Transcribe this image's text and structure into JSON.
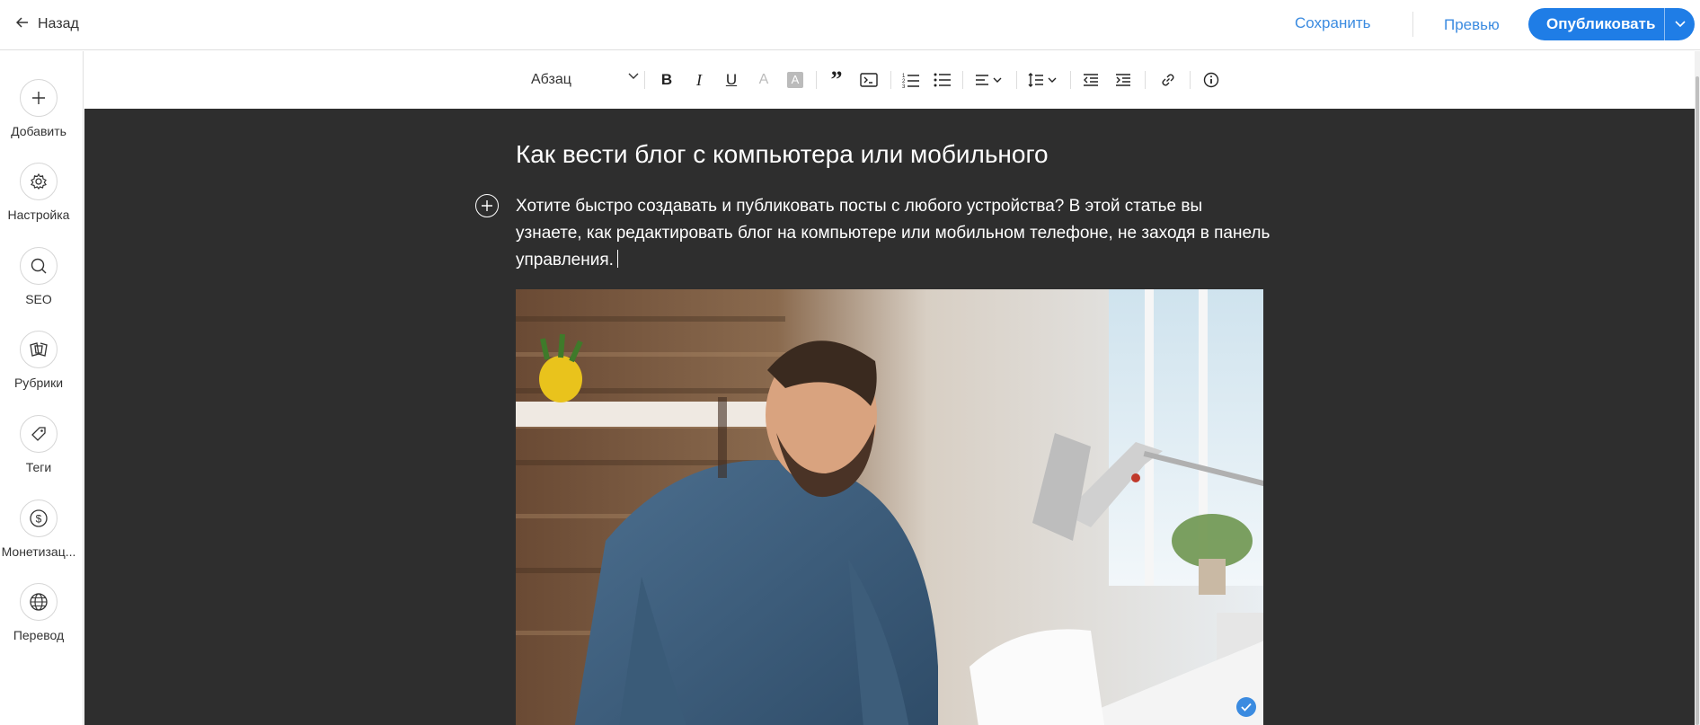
{
  "topbar": {
    "back_label": "Назад",
    "save_label": "Сохранить",
    "preview_label": "Превью",
    "publish_label": "Опубликовать"
  },
  "sidebar": {
    "items": [
      {
        "label": "Добавить",
        "icon": "plus-icon"
      },
      {
        "label": "Настройка",
        "icon": "gear-icon"
      },
      {
        "label": "SEO",
        "icon": "search-icon"
      },
      {
        "label": "Рубрики",
        "icon": "categories-icon"
      },
      {
        "label": "Теги",
        "icon": "tag-icon"
      },
      {
        "label": "Монетизац...",
        "icon": "dollar-icon"
      },
      {
        "label": "Перевод",
        "icon": "globe-icon"
      }
    ]
  },
  "toolbar": {
    "paragraph_style": "Абзац",
    "buttons": [
      "bold-icon",
      "italic-icon",
      "underline-icon",
      "text-color-icon",
      "highlight-icon",
      "quote-icon",
      "code-block-icon",
      "ordered-list-icon",
      "bullet-list-icon",
      "align-icon",
      "line-spacing-icon",
      "decrease-indent-icon",
      "increase-indent-icon",
      "link-icon",
      "info-icon"
    ]
  },
  "post": {
    "title": "Как вести блог с компьютера или мобильного",
    "body": "Хотите быстро создавать и публиковать посты с любого устройства? В этой статье вы узнаете, как редактировать блог на компьютере или мобильном телефоне, не заходя в панель управления."
  },
  "colors": {
    "accent": "#3b8be0",
    "publish_bg": "#1f7de6",
    "editor_bg": "#2e2e2e"
  }
}
